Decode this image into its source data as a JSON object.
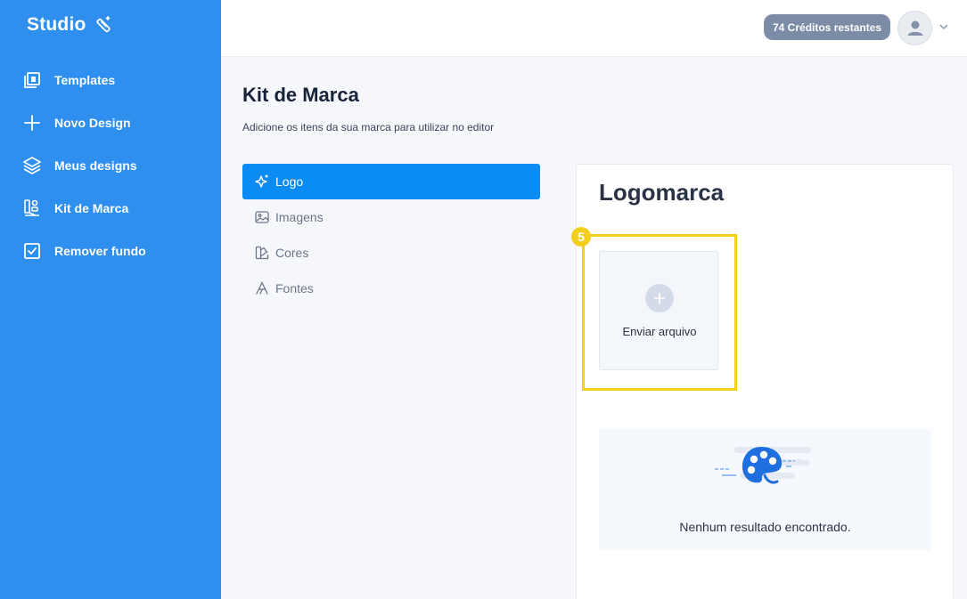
{
  "sidebar": {
    "brand": "Studio",
    "brand_icon": "magic-wand-icon",
    "items": [
      {
        "label": "Templates",
        "icon": "templates-icon"
      },
      {
        "label": "Novo Design",
        "icon": "plus-icon"
      },
      {
        "label": "Meus designs",
        "icon": "layers-icon"
      },
      {
        "label": "Kit de Marca",
        "icon": "brand-kit-icon"
      },
      {
        "label": "Remover fundo",
        "icon": "checkbox-icon"
      }
    ],
    "bg_color": "#2f8fef"
  },
  "header": {
    "credits": "74 Créditos restantes",
    "avatar_icon": "user-icon",
    "menu_icon": "chevron-down-icon"
  },
  "page": {
    "title": "Kit de Marca",
    "subtitle": "Adicione os itens da sua marca para utilizar no editor"
  },
  "tabs": [
    {
      "label": "Logo",
      "icon": "sparkle-icon",
      "active": true
    },
    {
      "label": "Imagens",
      "icon": "image-icon",
      "active": false
    },
    {
      "label": "Cores",
      "icon": "palette-icon",
      "active": false
    },
    {
      "label": "Fontes",
      "icon": "font-icon",
      "active": false
    }
  ],
  "panel": {
    "title": "Logomarca",
    "step_badge": "5",
    "upload_label": "Enviar arquivo",
    "empty_text": "Nenhum resultado encontrado."
  },
  "colors": {
    "accent": "#0b8cf5",
    "highlight": "#f2cf1d",
    "credits_badge": "#7d8ca6"
  }
}
